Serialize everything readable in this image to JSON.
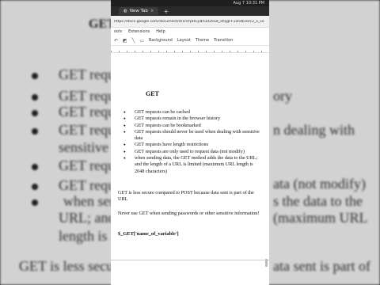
{
  "background": {
    "title": "GET",
    "lines": [
      "GET reque",
      "GET reque",
      "GET reque",
      "GET reque",
      "sensitive d",
      "GET reque",
      "GET reque",
      "when sen",
      "URL; and",
      "length is 2",
      "GET is less secur"
    ],
    "right_fragments": [
      "ory",
      "n dealing with",
      "ata (not modify)",
      "s the data to the",
      "(maximum URL",
      "ata sent is part of"
    ]
  },
  "status": {
    "time": "Aug 7  10:31 PM"
  },
  "browser": {
    "tab_title": "New Tab",
    "url": "https://docs.google.com/document/d/1hlYpRGy8rLkt2kSd_oflijgFF1oh4bTorc2_x_so"
  },
  "menu": [
    "ools",
    "Extensions",
    "Help"
  ],
  "toolbar": [
    "Background",
    "Layout",
    "Theme",
    "Transition"
  ],
  "doc": {
    "heading": "GET",
    "bullets": [
      "GET requests can be cached",
      "GET requests remain in the browser history",
      "GET requests can be bookmarked",
      "GET requests should never be used when dealing with sensitive data",
      "GET requests have length restrictions",
      "GET requests are only used to request data (not modify)",
      " when sending data, the GET method adds the data to the URL; and the length of a URL is limited (maximum URL length is 2048 characters)"
    ],
    "para1": "GET is less secure compared to POST because data sent is part of the URL",
    "para2": "Never use GET when sending passwords or other sensitive information!",
    "code": "$_GET['name_of_variable']"
  }
}
